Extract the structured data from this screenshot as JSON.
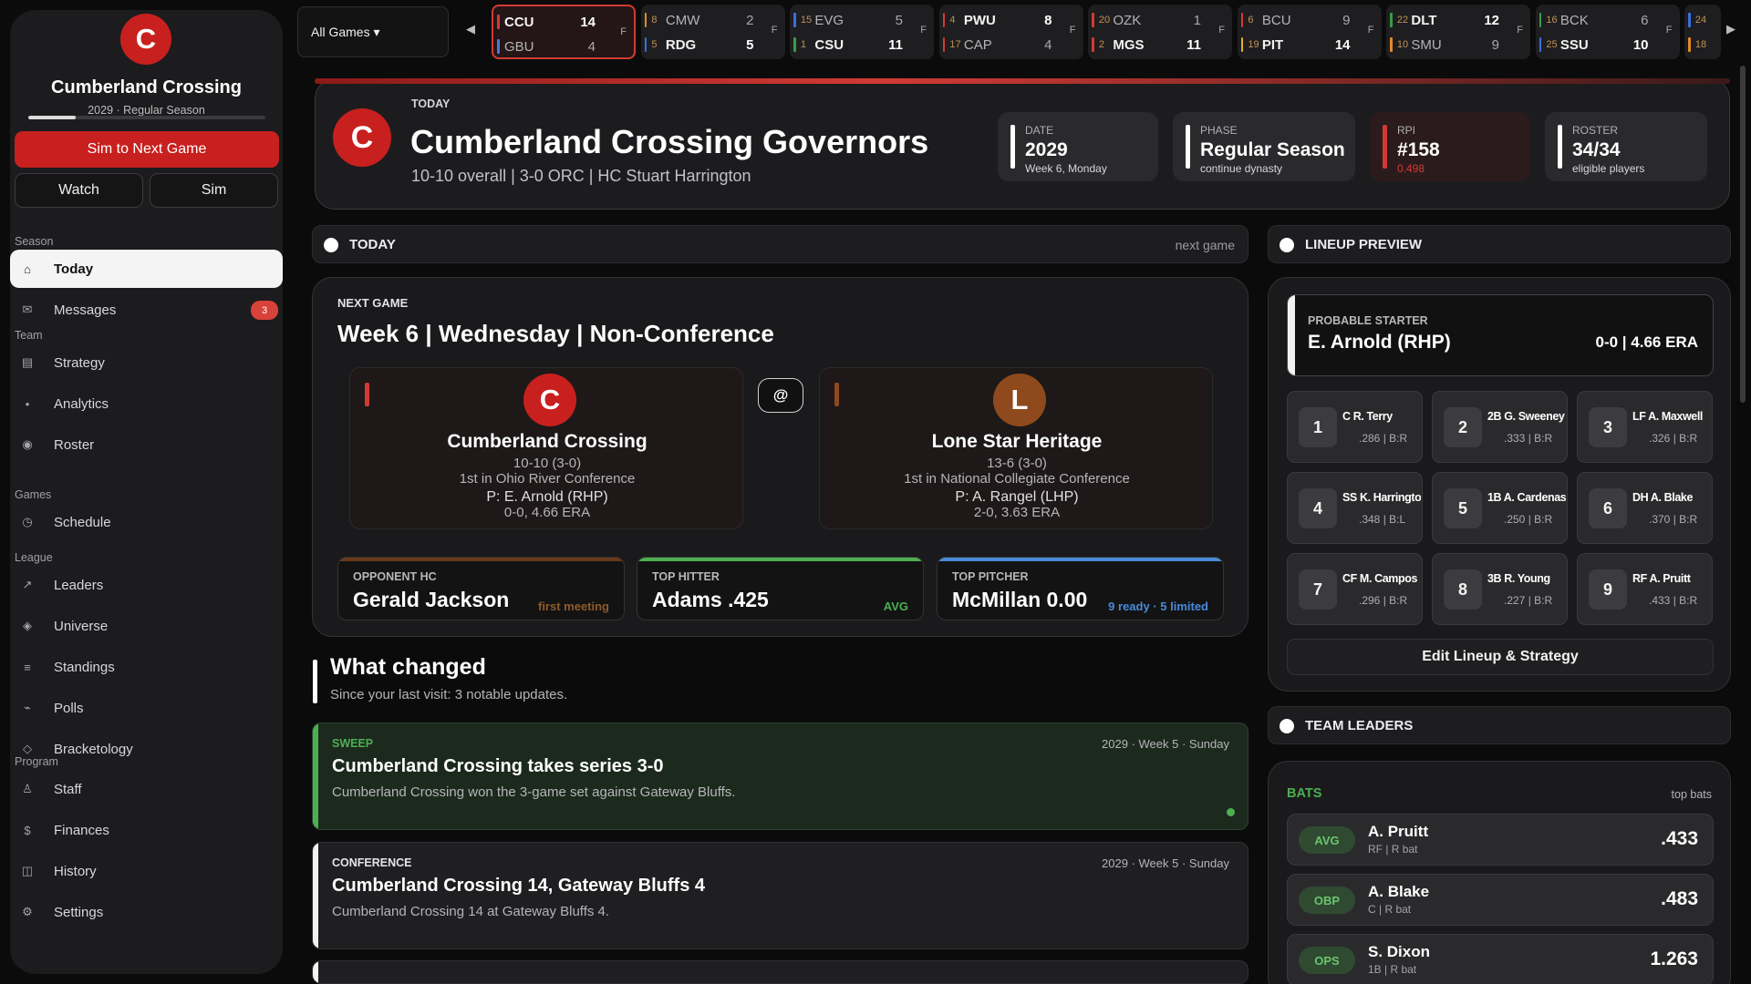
{
  "sidebar": {
    "logo_letter": "C",
    "team_name": "Cumberland Crossing",
    "season_line": "2029 · Regular Season",
    "season_progress": 0.2,
    "sim_next": "Sim to Next Game",
    "watch": "Watch",
    "sim": "Sim",
    "sections": [
      {
        "label": "Season",
        "items": [
          {
            "label": "Today",
            "icon": "home-icon",
            "glyph": "⌂",
            "active": true
          },
          {
            "label": "Messages",
            "icon": "mail-icon",
            "glyph": "✉",
            "badge": "3"
          }
        ]
      },
      {
        "label": "Team",
        "items": [
          {
            "label": "Strategy",
            "icon": "clipboard-icon",
            "glyph": "▤"
          },
          {
            "label": "Analytics",
            "icon": "dot-icon",
            "glyph": "•"
          },
          {
            "label": "Roster",
            "icon": "roster-icon",
            "glyph": "◉"
          }
        ]
      },
      {
        "label": "Games",
        "items": [
          {
            "label": "Schedule",
            "icon": "clock-icon",
            "glyph": "◷"
          }
        ]
      },
      {
        "label": "League",
        "items": [
          {
            "label": "Leaders",
            "icon": "trend-icon",
            "glyph": "↗"
          },
          {
            "label": "Universe",
            "icon": "diamond-icon",
            "glyph": "◈"
          },
          {
            "label": "Standings",
            "icon": "list-icon",
            "glyph": "≡"
          },
          {
            "label": "Polls",
            "icon": "wave-icon",
            "glyph": "⌁"
          },
          {
            "label": "Bracketology",
            "icon": "bracket-icon",
            "glyph": "◇"
          }
        ]
      },
      {
        "label": "Program",
        "items": [
          {
            "label": "Staff",
            "icon": "person-icon",
            "glyph": "♙"
          },
          {
            "label": "Finances",
            "icon": "dollar-icon",
            "glyph": "$"
          },
          {
            "label": "History",
            "icon": "book-icon",
            "glyph": "◫"
          },
          {
            "label": "Settings",
            "icon": "gear-icon",
            "glyph": "⚙"
          }
        ]
      }
    ]
  },
  "ticker": {
    "filter": "All Games ▾",
    "prev": "◀",
    "next": "▶",
    "games": [
      {
        "t1": {
          "seed": "",
          "abbr": "CCU",
          "score": "14",
          "color": "#d23a35",
          "win": true
        },
        "t2": {
          "seed": "",
          "abbr": "GBU",
          "score": "4",
          "color": "#4a77d8",
          "win": false
        },
        "status": "F",
        "selected": true
      },
      {
        "t1": {
          "seed": "8",
          "abbr": "CMW",
          "score": "2",
          "color": "#e08a2a",
          "win": false
        },
        "t2": {
          "seed": "5",
          "abbr": "RDG",
          "score": "5",
          "color": "#3a6fe0",
          "win": true
        },
        "status": "F"
      },
      {
        "t1": {
          "seed": "15",
          "abbr": "EVG",
          "score": "5",
          "color": "#3a6fe0",
          "win": false
        },
        "t2": {
          "seed": "1",
          "abbr": "CSU",
          "score": "11",
          "color": "#3a9a4a",
          "win": true
        },
        "status": "F"
      },
      {
        "t1": {
          "seed": "4",
          "abbr": "PWU",
          "score": "8",
          "color": "#d23a35",
          "win": true
        },
        "t2": {
          "seed": "17",
          "abbr": "CAP",
          "score": "4",
          "color": "#d23a35",
          "win": false
        },
        "status": "F"
      },
      {
        "t1": {
          "seed": "20",
          "abbr": "OZK",
          "score": "1",
          "color": "#d23a35",
          "win": false
        },
        "t2": {
          "seed": "2",
          "abbr": "MGS",
          "score": "11",
          "color": "#d23a35",
          "win": true
        },
        "status": "F"
      },
      {
        "t1": {
          "seed": "6",
          "abbr": "BCU",
          "score": "9",
          "color": "#d23a35",
          "win": false
        },
        "t2": {
          "seed": "19",
          "abbr": "PIT",
          "score": "14",
          "color": "#e0b02a",
          "win": true
        },
        "status": "F"
      },
      {
        "t1": {
          "seed": "22",
          "abbr": "DLT",
          "score": "12",
          "color": "#3a9a4a",
          "win": true
        },
        "t2": {
          "seed": "10",
          "abbr": "SMU",
          "score": "9",
          "color": "#e08a2a",
          "win": false
        },
        "status": "F"
      },
      {
        "t1": {
          "seed": "16",
          "abbr": "BCK",
          "score": "6",
          "color": "#3a9a4a",
          "win": false
        },
        "t2": {
          "seed": "25",
          "abbr": "SSU",
          "score": "10",
          "color": "#3a6fe0",
          "win": true
        },
        "status": "F"
      },
      {
        "t1": {
          "seed": "24",
          "abbr": "",
          "score": "",
          "color": "#3a6fe0",
          "win": false
        },
        "t2": {
          "seed": "18",
          "abbr": "",
          "score": "",
          "color": "#e08a2a",
          "win": false
        },
        "status": ""
      }
    ]
  },
  "header": {
    "logo_letter": "C",
    "kicker": "TODAY",
    "title": "Cumberland Crossing Governors",
    "subtitle": "10-10 overall | 3-0 ORC | HC Stuart Harrington",
    "stats": [
      {
        "label": "DATE",
        "value": "2029",
        "note": "Week 6, Monday"
      },
      {
        "label": "PHASE",
        "value": "Regular Season",
        "note": "continue dynasty"
      },
      {
        "label": "RPI",
        "value": "#158",
        "note": "0.498"
      },
      {
        "label": "ROSTER",
        "value": "34/34",
        "note": "eligible players"
      }
    ]
  },
  "today_bar": {
    "title": "TODAY",
    "right": "next game"
  },
  "lineup_bar": {
    "title": "LINEUP PREVIEW"
  },
  "leaders_bar": {
    "title": "TEAM LEADERS"
  },
  "next_game": {
    "kicker": "NEXT GAME",
    "title": "Week 6  |  Wednesday  |  Non-Conference",
    "at": "@",
    "home": {
      "letter": "C",
      "name": "Cumberland Crossing",
      "record": "10-10  (3-0)",
      "standing": "1st in Ohio River Conference",
      "pitcher": "P: E. Arnold (RHP)",
      "pitcher_line": "0-0, 4.66 ERA",
      "color": "#c8201e"
    },
    "away": {
      "letter": "L",
      "name": "Lone Star Heritage",
      "record": "13-6  (3-0)",
      "standing": "1st in National Collegiate Conference",
      "pitcher": "P: A. Rangel (LHP)",
      "pitcher_line": "2-0, 3.63 ERA",
      "color": "#8e4a1c"
    },
    "cards": [
      {
        "label": "OPPONENT HC",
        "value": "Gerald Jackson",
        "note": "first meeting",
        "accent": "#8e4a1c",
        "note_color": "#8e5a2a"
      },
      {
        "label": "TOP HITTER",
        "value": "Adams .425",
        "note": "AVG",
        "accent": "#4caf50",
        "note_color": "#4caf50"
      },
      {
        "label": "TOP PITCHER",
        "value": "McMillan 0.00",
        "note": "9 ready · 5 limited",
        "accent": "#4a8ad8",
        "note_color": "#4a8ad8"
      }
    ]
  },
  "what_changed": {
    "title": "What changed",
    "subtitle": "Since your last visit: 3 notable updates.",
    "items": [
      {
        "kicker": "SWEEP",
        "date": "2029 · Week 5 · Sunday",
        "title": "Cumberland Crossing takes series 3-0",
        "text": "Cumberland Crossing won the 3-game set against Gateway Bluffs.",
        "color": "#4caf50"
      },
      {
        "kicker": "CONFERENCE",
        "date": "2029 · Week 5 · Sunday",
        "title": "Cumberland Crossing 14, Gateway Bluffs 4",
        "text": "Cumberland Crossing 14 at Gateway Bluffs 4.",
        "color": "#f2f2f2"
      }
    ]
  },
  "lineup": {
    "starter_label": "PROBABLE STARTER",
    "starter_name": "E. Arnold (RHP)",
    "starter_line": "0-0 | 4.66 ERA",
    "slots": [
      {
        "n": "1",
        "player": "C R. Terry",
        "stat": ".286 | B:R"
      },
      {
        "n": "2",
        "player": "2B G. Sweeney",
        "stat": ".333 | B:R"
      },
      {
        "n": "3",
        "player": "LF A. Maxwell",
        "stat": ".326 | B:R"
      },
      {
        "n": "4",
        "player": "SS K. Harrington",
        "stat": ".348 | B:L"
      },
      {
        "n": "5",
        "player": "1B A. Cardenas",
        "stat": ".250 | B:R"
      },
      {
        "n": "6",
        "player": "DH A. Blake",
        "stat": ".370 | B:R"
      },
      {
        "n": "7",
        "player": "CF M. Campos",
        "stat": ".296 | B:R"
      },
      {
        "n": "8",
        "player": "3B R. Young",
        "stat": ".227 | B:R"
      },
      {
        "n": "9",
        "player": "RF A. Pruitt",
        "stat": ".433 | B:R"
      }
    ],
    "edit_button": "Edit Lineup & Strategy"
  },
  "leaders": {
    "category": "BATS",
    "right": "top bats",
    "rows": [
      {
        "stat": "AVG",
        "name": "A. Pruitt",
        "pos": "RF | R bat",
        "value": ".433"
      },
      {
        "stat": "OBP",
        "name": "A. Blake",
        "pos": "C | R bat",
        "value": ".483"
      },
      {
        "stat": "OPS",
        "name": "S. Dixon",
        "pos": "1B | R bat",
        "value": "1.263"
      }
    ]
  }
}
